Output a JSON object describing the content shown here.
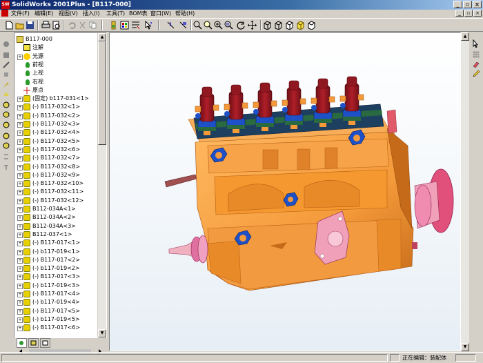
{
  "window": {
    "title": "SolidWorks 2001Plus - [B117-000]",
    "app_icon_text": "SW"
  },
  "menu": [
    "文件(F)",
    "编辑(E)",
    "视图(V)",
    "插入(I)",
    "工具(T)",
    "BOM表",
    "窗口(W)",
    "帮助(H)"
  ],
  "tree": {
    "root": "B117-000",
    "items": [
      {
        "label": "注解",
        "icon": "annotation-icon",
        "exp": false
      },
      {
        "label": "光源",
        "icon": "lighting-icon",
        "exp": true
      },
      {
        "label": "前视",
        "icon": "plane-icon",
        "exp": false
      },
      {
        "label": "上视",
        "icon": "plane-icon",
        "exp": false
      },
      {
        "label": "右视",
        "icon": "plane-icon",
        "exp": false
      },
      {
        "label": "原点",
        "icon": "origin-icon",
        "exp": false
      },
      {
        "label": "(固定) b117-031<1>",
        "icon": "part-icon",
        "exp": true
      },
      {
        "label": "(-) B117-032<1>",
        "icon": "part-icon",
        "exp": true
      },
      {
        "label": "(-) B117-032<2>",
        "icon": "part-icon",
        "exp": true
      },
      {
        "label": "(-) B117-032<3>",
        "icon": "part-icon",
        "exp": true
      },
      {
        "label": "(-) B117-032<4>",
        "icon": "part-icon",
        "exp": true
      },
      {
        "label": "(-) B117-032<5>",
        "icon": "part-icon",
        "exp": true
      },
      {
        "label": "(-) B117-032<6>",
        "icon": "part-icon",
        "exp": true
      },
      {
        "label": "(-) B117-032<7>",
        "icon": "part-icon",
        "exp": true
      },
      {
        "label": "(-) B117-032<8>",
        "icon": "part-icon",
        "exp": true
      },
      {
        "label": "(-) B117-032<9>",
        "icon": "part-icon",
        "exp": true
      },
      {
        "label": "(-) B117-032<10>",
        "icon": "part-icon",
        "exp": true
      },
      {
        "label": "(-) B117-032<11>",
        "icon": "part-icon",
        "exp": true
      },
      {
        "label": "(-) B117-032<12>",
        "icon": "part-icon",
        "exp": true
      },
      {
        "label": "B112-034A<1>",
        "icon": "part-icon",
        "exp": true
      },
      {
        "label": "B112-034A<2>",
        "icon": "part-icon",
        "exp": true
      },
      {
        "label": "B112-034A<3>",
        "icon": "part-icon",
        "exp": true
      },
      {
        "label": "B112-037<1>",
        "icon": "part-icon",
        "exp": true
      },
      {
        "label": "(-) B117-017<1>",
        "icon": "part-icon",
        "exp": true
      },
      {
        "label": "(-) b117-019<1>",
        "icon": "part-icon",
        "exp": true
      },
      {
        "label": "(-) B117-017<2>",
        "icon": "part-icon",
        "exp": true
      },
      {
        "label": "(-) b117-019<2>",
        "icon": "part-icon",
        "exp": true
      },
      {
        "label": "(-) B117-017<3>",
        "icon": "part-icon",
        "exp": true
      },
      {
        "label": "(-) b117-019<3>",
        "icon": "part-icon",
        "exp": true
      },
      {
        "label": "(-) B117-017<4>",
        "icon": "part-icon",
        "exp": true
      },
      {
        "label": "(-) b117-019<4>",
        "icon": "part-icon",
        "exp": true
      },
      {
        "label": "(-) B117-017<5>",
        "icon": "part-icon",
        "exp": true
      },
      {
        "label": "(-) b117-019<5>",
        "icon": "part-icon",
        "exp": true
      },
      {
        "label": "(-) B117-017<6>",
        "icon": "part-icon",
        "exp": true
      }
    ]
  },
  "status": {
    "text": "正在编辑：装配体"
  },
  "colors": {
    "body": "#f49a3a",
    "body_shadow": "#c46a18",
    "injector_red": "#a0141e",
    "nut_blue": "#1e50c8",
    "flange_pink": "#e0507a",
    "plate_pink": "#f0a0b8",
    "titlebar": "#0a246a"
  }
}
